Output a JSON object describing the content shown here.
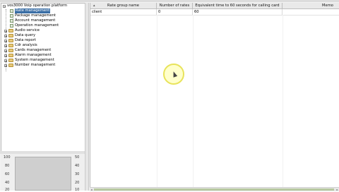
{
  "tree": {
    "root_label": "vos3000 Voip operation platform",
    "items": [
      {
        "label": "Rate management",
        "selected": true,
        "type": "leaf"
      },
      {
        "label": "Package management",
        "selected": false,
        "type": "leaf"
      },
      {
        "label": "Account management",
        "selected": false,
        "type": "leaf"
      },
      {
        "label": "Operation management",
        "selected": false,
        "type": "leaf"
      },
      {
        "label": "Audio service",
        "selected": false,
        "type": "folder"
      },
      {
        "label": "Data query",
        "selected": false,
        "type": "folder"
      },
      {
        "label": "Data report",
        "selected": false,
        "type": "folder"
      },
      {
        "label": "Cdr analysis",
        "selected": false,
        "type": "folder"
      },
      {
        "label": "Cards management",
        "selected": false,
        "type": "folder"
      },
      {
        "label": "Alarm management",
        "selected": false,
        "type": "folder"
      },
      {
        "label": "System management",
        "selected": false,
        "type": "folder"
      },
      {
        "label": "Number management",
        "selected": false,
        "type": "folder"
      }
    ]
  },
  "chart": {
    "left_ticks": [
      "100",
      "80",
      "60",
      "40",
      "20"
    ],
    "right_ticks": [
      "50",
      "40",
      "30",
      "20",
      "10"
    ]
  },
  "table": {
    "headers": [
      "Rate group name",
      "Number of rates",
      "Equivalent time to 60 seconds for calling card",
      "Memo"
    ],
    "rows": [
      [
        "client",
        "0",
        "60",
        ""
      ]
    ]
  },
  "colors": {
    "selection": "#3a6ea5",
    "folder": "#e7c97a",
    "scroll_thumb": "#b7c8a0",
    "cursor_highlight": "#e8e35a"
  }
}
